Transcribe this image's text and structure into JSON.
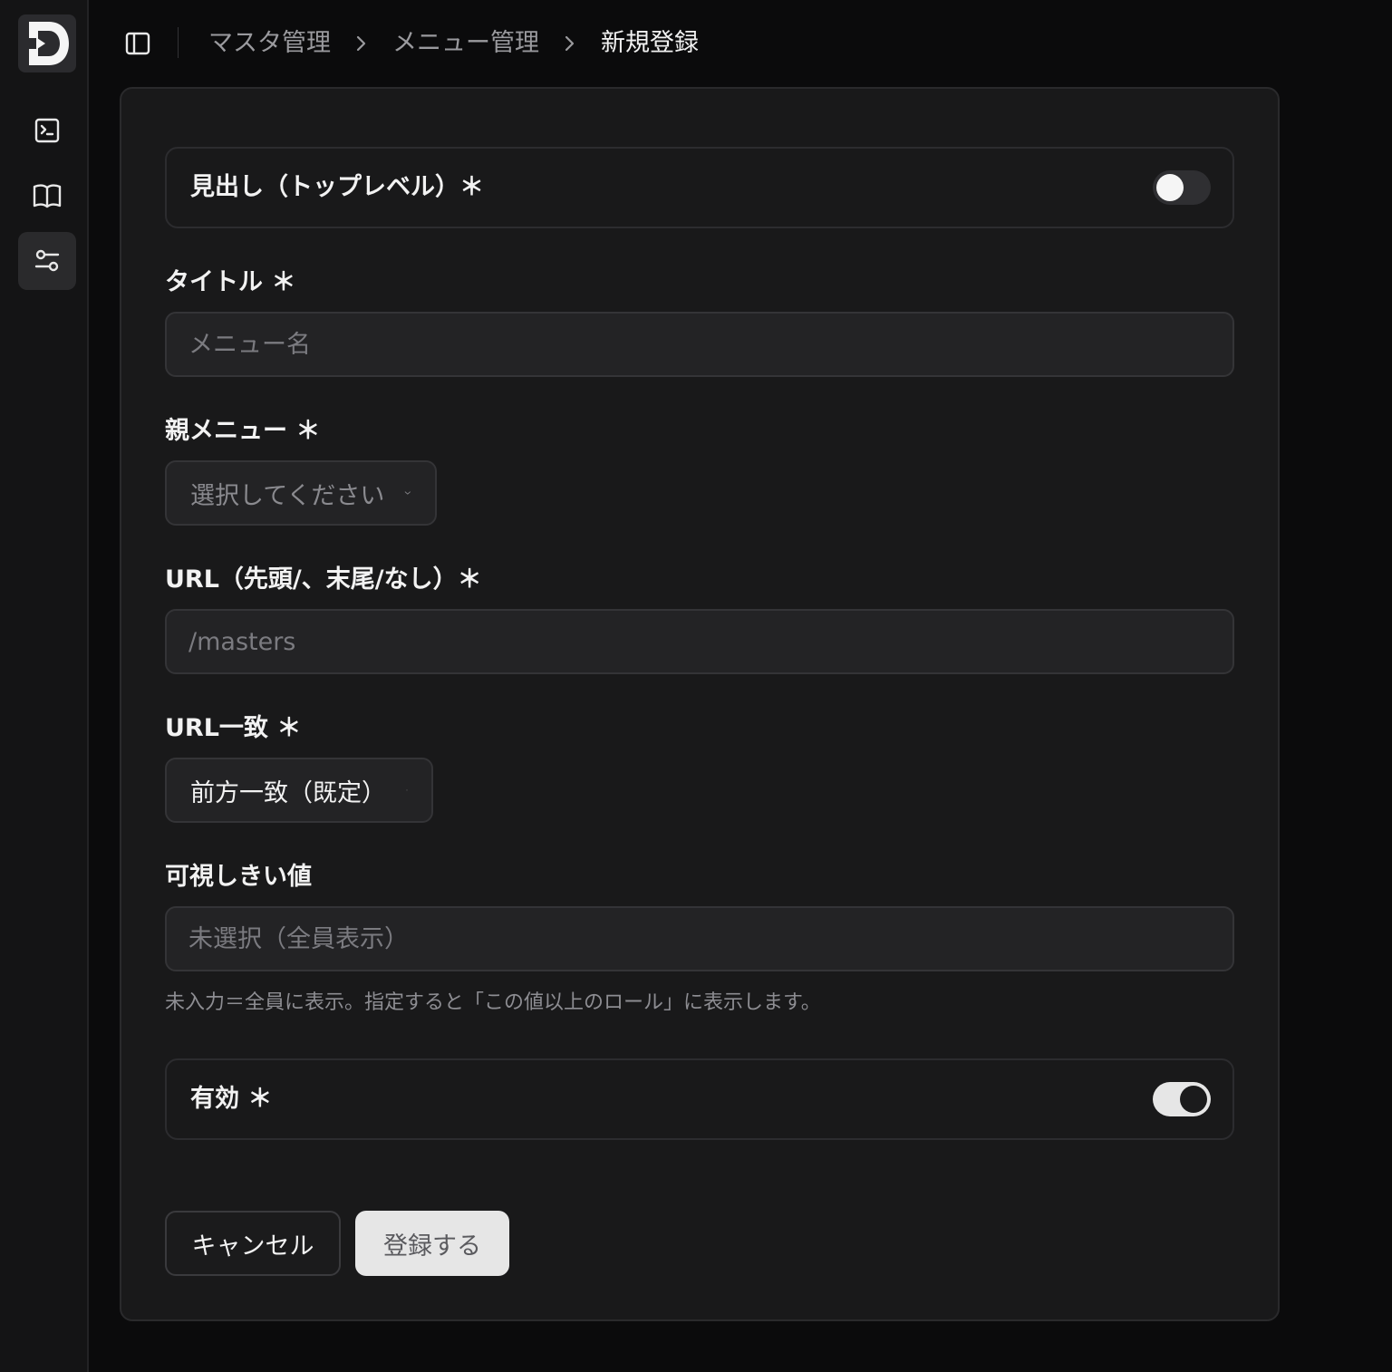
{
  "nav": {
    "logo_letter": "D",
    "icons": [
      "terminal-icon",
      "book-icon",
      "sliders-icon"
    ]
  },
  "breadcrumb": {
    "items": [
      "マスタ管理",
      "メニュー管理",
      "新規登録"
    ]
  },
  "form": {
    "heading_toggle": {
      "label": "見出し（トップレベル）＊",
      "on": false
    },
    "title": {
      "label": "タイトル ＊",
      "placeholder": "メニュー名",
      "value": ""
    },
    "parent_menu": {
      "label": "親メニュー ＊",
      "selected": "選択してください"
    },
    "url": {
      "label": "URL（先頭/、末尾/なし）＊",
      "placeholder": "/masters",
      "value": ""
    },
    "url_match": {
      "label": "URL一致 ＊",
      "selected": "前方一致（既定）"
    },
    "visibility": {
      "label": "可視しきい値",
      "placeholder": "未選択（全員表示）",
      "hint": "未入力＝全員に表示。指定すると「この値以上のロール」に表示します。"
    },
    "enabled_toggle": {
      "label": "有効 ＊",
      "on": true
    },
    "cancel_label": "キャンセル",
    "submit_label": "登録する"
  },
  "colors": {
    "background": "#0b0b0c",
    "card": "#19191a",
    "input_bg": "#232325",
    "border": "#343437",
    "text": "#f2f2f2",
    "muted": "#8d8d92",
    "primary_button": "#e6e6e6"
  }
}
